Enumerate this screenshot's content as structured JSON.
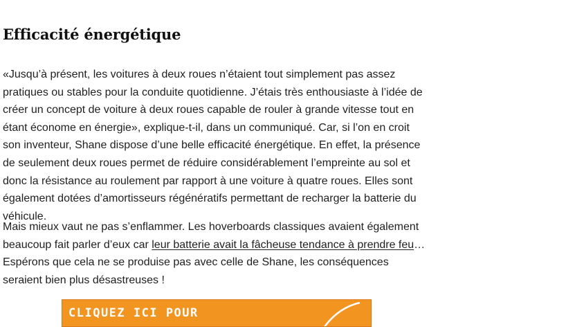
{
  "article": {
    "heading": "Efficacité énergétique",
    "paragraph1": "«Jusqu’à présent, les voitures à deux roues n’étaient tout simplement pas assez pratiques ou stables pour la conduite quotidienne. J’étais très enthousiaste à l’idée de créer un concept de voiture à deux roues capable de rouler à grande vitesse tout en étant économe en énergie», explique-t-il, dans un communiqué. Car, si l’on en croit son inventeur, Shane dispose d’une belle efficacité énergétique. En effet, la présence de seulement deux roues permet de réduire considérablement l’empreinte au sol et donc la résistance au roulement par rapport à une voiture à quatre roues. Elles sont également dotées d’amortisseurs régénératifs permettant de recharger la batterie du véhicule.",
    "paragraph2_before": "Mais mieux vaut ne pas s’enflammer. Les hoverboards classiques avaient également beaucoup fait parler d’eux car ",
    "paragraph2_link": "leur batterie avait la fâcheuse tendance à prendre feu",
    "paragraph2_after": "… Espérons que cela ne se produise pas avec celle de Shane, les conséquences seraient bien plus désastreuses !"
  },
  "banner": {
    "text": "CLIQUEZ ICI POUR",
    "background_color": "#f29420",
    "text_color": "#ffffff"
  }
}
